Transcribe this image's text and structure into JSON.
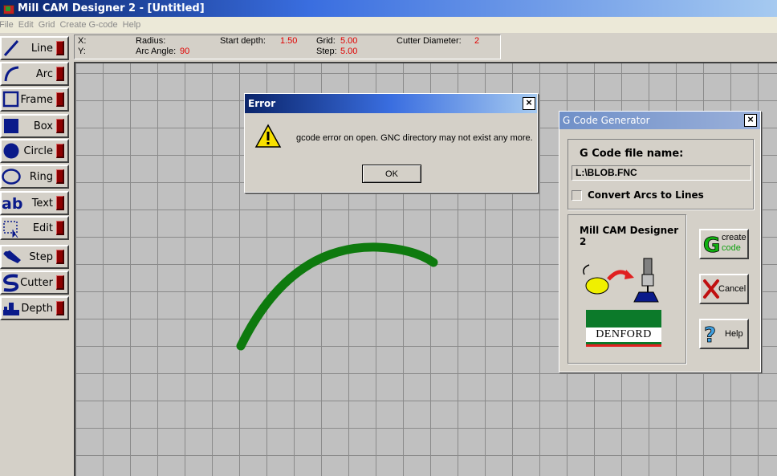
{
  "window": {
    "title": "Mill CAM Designer 2 - [Untitled]"
  },
  "menu": [
    "File",
    "Edit",
    "Grid",
    "Create G-code",
    "Help"
  ],
  "toolbar": [
    {
      "label": "Line",
      "icon": "line-icon"
    },
    {
      "label": "Arc",
      "icon": "arc-icon"
    },
    {
      "label": "Frame",
      "icon": "frame-icon"
    },
    {
      "label": "Box",
      "icon": "box-icon"
    },
    {
      "label": "Circle",
      "icon": "circle-icon"
    },
    {
      "label": "Ring",
      "icon": "ring-icon"
    },
    {
      "label": "Text",
      "icon": "text-icon"
    },
    {
      "label": "Edit",
      "icon": "edit-icon"
    },
    {
      "label": "Step",
      "icon": "step-icon"
    },
    {
      "label": "Cutter",
      "icon": "cutter-icon"
    },
    {
      "label": "Depth",
      "icon": "depth-icon"
    }
  ],
  "info": {
    "x_label": "X:",
    "y_label": "Y:",
    "radius_label": "Radius:",
    "arc_angle_label": "Arc Angle:",
    "arc_angle_value": "90",
    "start_depth_label": "Start depth:",
    "start_depth_value": "1.50",
    "grid_label": "Grid:",
    "grid_value": "5.00",
    "step_label": "Step:",
    "step_value": "5.00",
    "cutter_label": "Cutter Diameter:",
    "cutter_value": "2"
  },
  "error_dialog": {
    "title": "Error",
    "message": "gcode error on open. GNC directory may not exist any more.",
    "ok_label": "OK",
    "close_glyph": "×"
  },
  "gcode_dialog": {
    "title": "G Code Generator",
    "close_glyph": "×",
    "file_name_label": "G Code file name:",
    "file_name_value": "L:\\BLOB.FNC",
    "convert_label": "Convert Arcs to Lines",
    "convert_checked": false,
    "product_name": "Mill CAM Designer 2",
    "create_label_1": "create",
    "create_label_2": "code",
    "cancel_label": "Cancel",
    "help_label": "Help",
    "brand": "DENFORD"
  },
  "colors": {
    "accent_blue": "#0a246a",
    "arc_green": "#0e7a0e",
    "error_red": "#e00000",
    "brand_green": "#0c7a2a"
  }
}
